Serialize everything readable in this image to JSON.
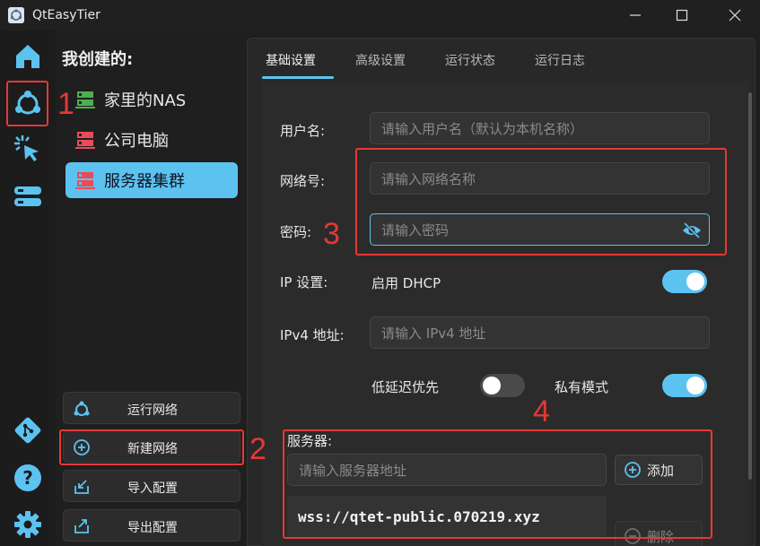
{
  "window": {
    "title": "QtEasyTier",
    "controls": [
      "minimize",
      "maximize",
      "close"
    ]
  },
  "rail": {
    "items": [
      {
        "name": "home-icon"
      },
      {
        "name": "network-icon",
        "selected": true
      },
      {
        "name": "click-icon"
      },
      {
        "name": "servers-icon"
      }
    ],
    "bottom": [
      {
        "name": "git-icon"
      },
      {
        "name": "help-icon"
      },
      {
        "name": "settings-icon"
      }
    ]
  },
  "network_panel": {
    "title": "我创建的:",
    "networks": [
      {
        "label": "家里的NAS",
        "icon_color": "#4caf50",
        "active": false
      },
      {
        "label": "公司电脑",
        "icon_color": "#e84c5a",
        "active": false
      },
      {
        "label": "服务器集群",
        "icon_color": "#e84c5a",
        "active": true
      }
    ],
    "buttons": {
      "run": "运行网络",
      "new": "新建网络",
      "import": "导入配置",
      "export": "导出配置"
    }
  },
  "tabs": [
    {
      "label": "基础设置",
      "active": true
    },
    {
      "label": "高级设置",
      "active": false
    },
    {
      "label": "运行状态",
      "active": false
    },
    {
      "label": "运行日志",
      "active": false
    }
  ],
  "form": {
    "username": {
      "label": "用户名:",
      "placeholder": "请输入用户名（默认为本机名称）",
      "value": ""
    },
    "network_name": {
      "label": "网络号:",
      "placeholder": "请输入网络名称",
      "value": ""
    },
    "password": {
      "label": "密码:",
      "placeholder": "请输入密码",
      "value": ""
    },
    "ip": {
      "label": "IP 设置:",
      "dhcp_label": "启用 DHCP",
      "dhcp_on": true
    },
    "ipv4": {
      "label": "IPv4 地址:",
      "placeholder": "请输入 IPv4 地址",
      "value": ""
    },
    "low_latency": {
      "label": "低延迟优先",
      "on": false
    },
    "private_mode": {
      "label": "私有模式",
      "on": true
    },
    "servers": {
      "label": "服务器:",
      "placeholder": "请输入服务器地址",
      "add_label": "添加",
      "delete_label": "删除",
      "list": [
        "wss://qtet-public.070219.xyz"
      ]
    }
  },
  "annotations": [
    "1",
    "2",
    "3",
    "4"
  ],
  "colors": {
    "accent": "#5cc3f0",
    "annotation": "#e53935"
  }
}
